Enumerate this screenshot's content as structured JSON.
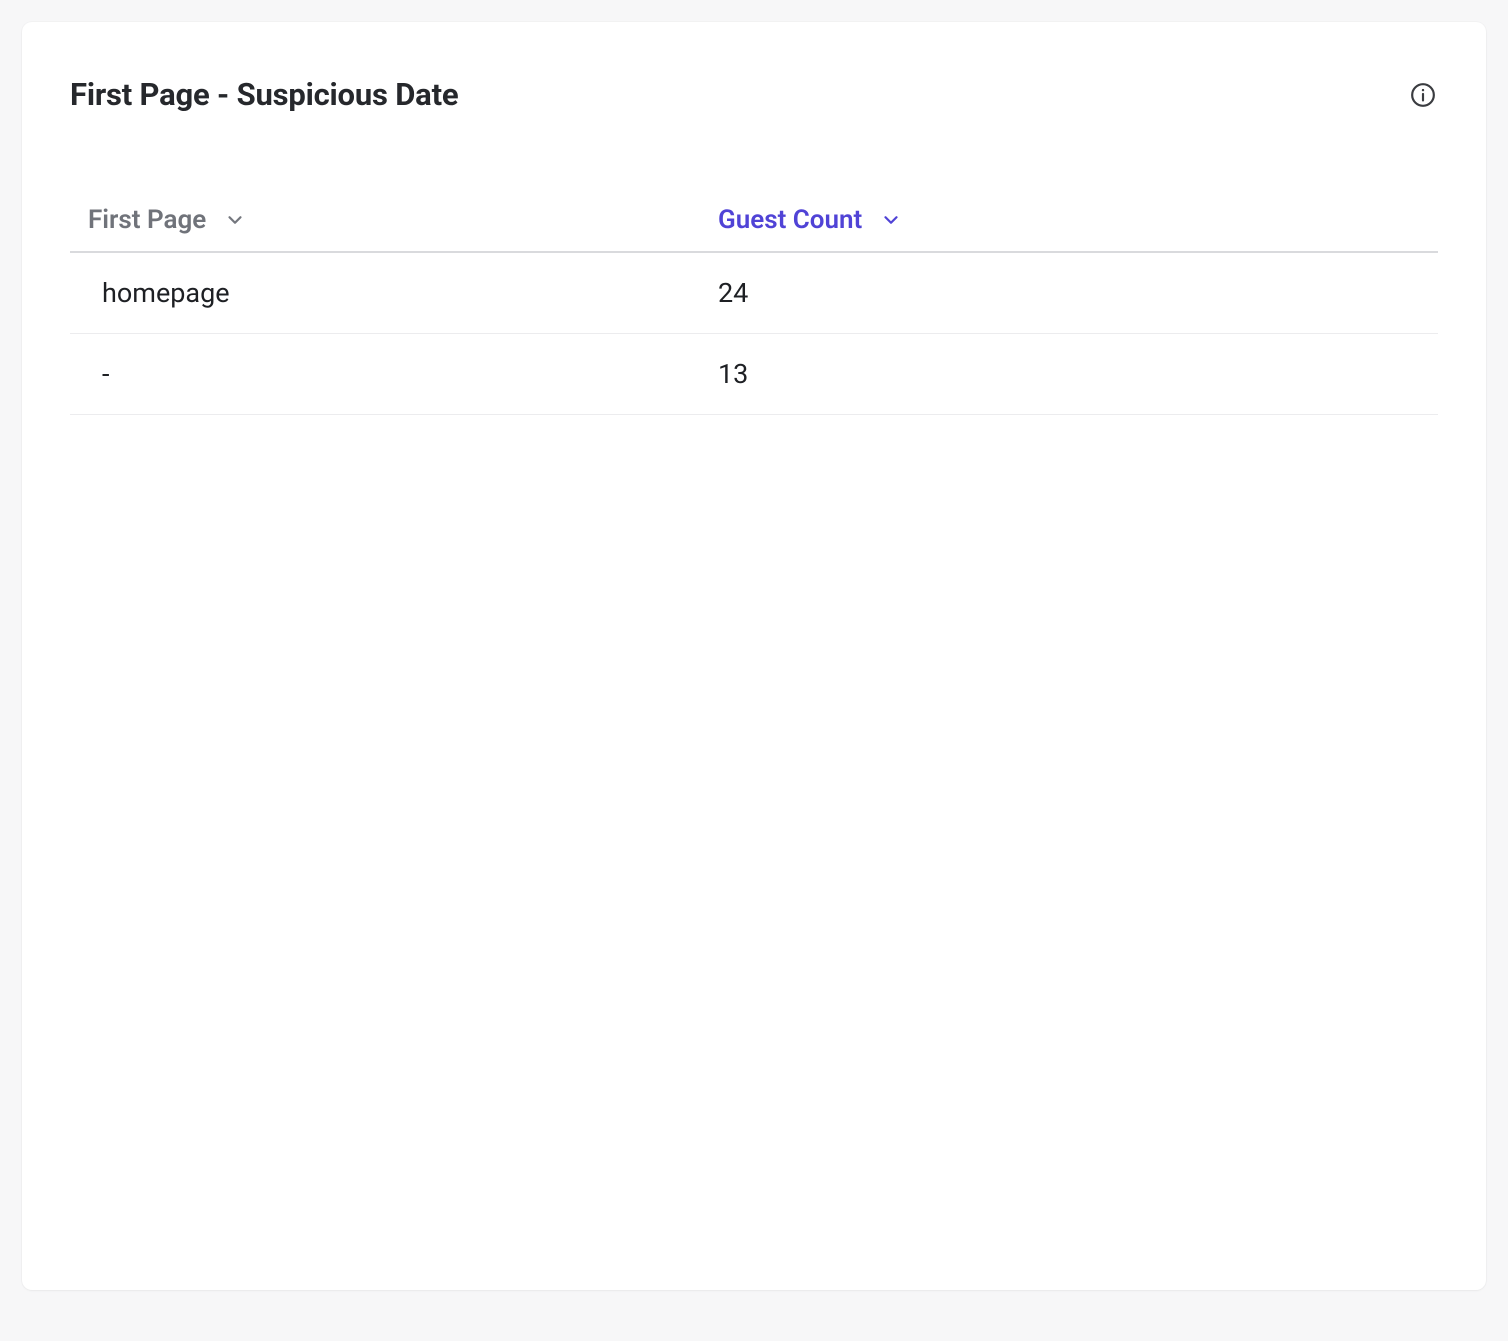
{
  "card": {
    "title": "First Page - Suspicious Date"
  },
  "table": {
    "columns": [
      {
        "label": "First Page",
        "sorted": false
      },
      {
        "label": "Guest Count",
        "sorted": true
      }
    ],
    "rows": [
      {
        "page": "homepage",
        "count": "24"
      },
      {
        "page": "-",
        "count": "13"
      }
    ]
  }
}
